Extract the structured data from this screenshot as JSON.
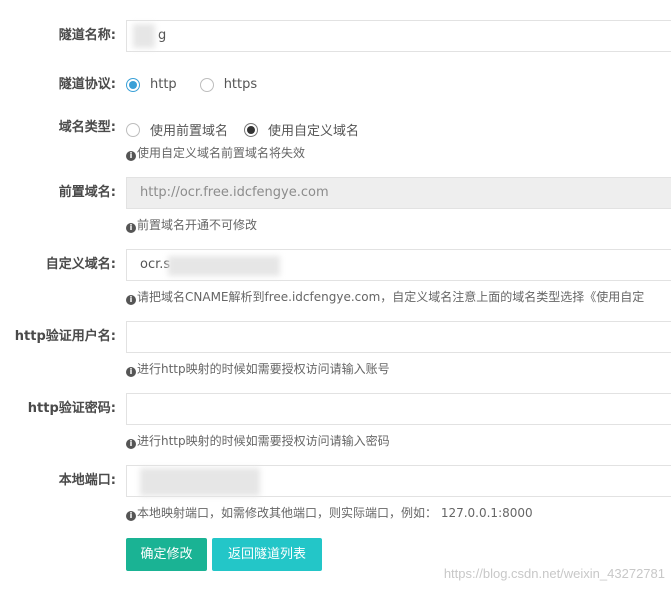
{
  "form": {
    "tunnel_name": {
      "label": "隧道名称:",
      "value": "g"
    },
    "tunnel_protocol": {
      "label": "隧道协议:",
      "options": [
        "http",
        "https"
      ],
      "selected": "http"
    },
    "domain_type": {
      "label": "域名类型:",
      "options": [
        "使用前置域名",
        "使用自定义域名"
      ],
      "selected": "使用自定义域名",
      "help": "使用自定义域名前置域名将失效"
    },
    "prefix_domain": {
      "label": "前置域名:",
      "value": "http://ocr.free.idcfengye.com",
      "help": "前置域名开通不可修改"
    },
    "custom_domain": {
      "label": "自定义域名:",
      "value": "ocr.s",
      "help": "请把域名CNAME解析到free.idcfengye.com，自定义域名注意上面的域名类型选择《使用自定"
    },
    "http_user": {
      "label": "http验证用户名:",
      "value": "",
      "help": "进行http映射的时候如需要授权访问请输入账号"
    },
    "http_password": {
      "label": "http验证密码:",
      "value": "",
      "help": "进行http映射的时候如需要授权访问请输入密码"
    },
    "local_port": {
      "label": "本地端口:",
      "value": "",
      "help": "本地映射端口，如需修改其他端口，则实际端口，例如：  127.0.0.1:8000"
    }
  },
  "buttons": {
    "confirm": "确定修改",
    "back": "返回隧道列表"
  },
  "watermark": "https://blog.csdn.net/weixin_43272781",
  "colors": {
    "primary_button": "#1ab394",
    "secondary_button": "#23c6c8",
    "radio_active": "#39a0d7"
  }
}
